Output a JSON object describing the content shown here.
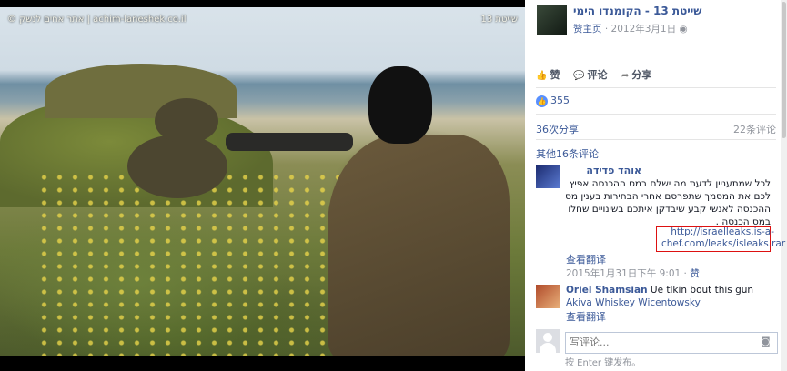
{
  "photo": {
    "watermark_left": "© אתר אחים לנשק | achim-laneshek.co.il",
    "watermark_right": "שייטת 13"
  },
  "post": {
    "page_name": "שייטת 13 - הקומנדו הימי",
    "page_like": "赞主页",
    "date": "2012年3月1日",
    "visibility_icon": "globe-icon"
  },
  "actions": {
    "like": "赞",
    "comment": "评论",
    "share": "分享"
  },
  "stats": {
    "likes": "355",
    "shares": "36次分享",
    "comments": "22条评论",
    "more_comments": "其他16条评论"
  },
  "comments": [
    {
      "name": "אוהד פדידה",
      "text": "לכל שמתעניין לדעת מה ישלם במס ההכנסה אפיץ לכם את המסמך שתפרסם אחרי הבחירות בענין מס ההכנסה לאנשי קבע שיבדקן איתכם בשינויים שחלו במס הכנסה .",
      "link_line1": "http://israelleaks.is-a-",
      "link_line2": "chef.com/leaks/isleaks.rar",
      "see_translation": "查看翻译",
      "time": "2015年1月31日下午 9:01",
      "like": "赞"
    },
    {
      "name": "Oriel Shamsian",
      "text": "Ue tlkin bout this gun",
      "mention": "Akiva Whiskey Wicentowsky",
      "see_translation": "查看翻译"
    }
  ],
  "composer": {
    "placeholder": "写评论...",
    "hint": "按 Enter 键发布。"
  },
  "colors": {
    "link": "#3b5998",
    "muted": "#90949c",
    "highlight_box": "#dd1111"
  }
}
